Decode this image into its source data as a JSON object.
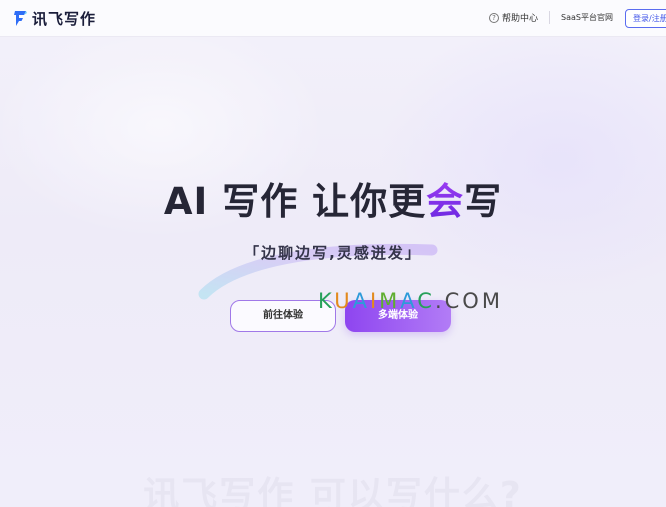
{
  "header": {
    "logo_text": "讯飞写作",
    "help_label": "帮助中心",
    "help_icon": "question-circle-icon",
    "saas_label": "SaaS平台官网",
    "login_label": "登录/注册"
  },
  "hero": {
    "title_prefix": "AI 写作 让你更",
    "title_accent": "会",
    "title_suffix": "写",
    "subtitle": "「边聊边写,灵感迸发」",
    "btn_secondary": "前往体验",
    "btn_primary": "多端体验"
  },
  "watermark": {
    "k": "K",
    "u": "U",
    "a": "A",
    "i": "I",
    "m": "M",
    "a2": "A",
    "c": "C",
    "dot": ".COM"
  },
  "section": {
    "heading": "讯飞写作 可以写什么?"
  },
  "colors": {
    "accent_start": "#9b3cf2",
    "accent_end": "#6a28e0",
    "primary_btn": "#8e45f0",
    "login_border": "#5a6cf0"
  }
}
